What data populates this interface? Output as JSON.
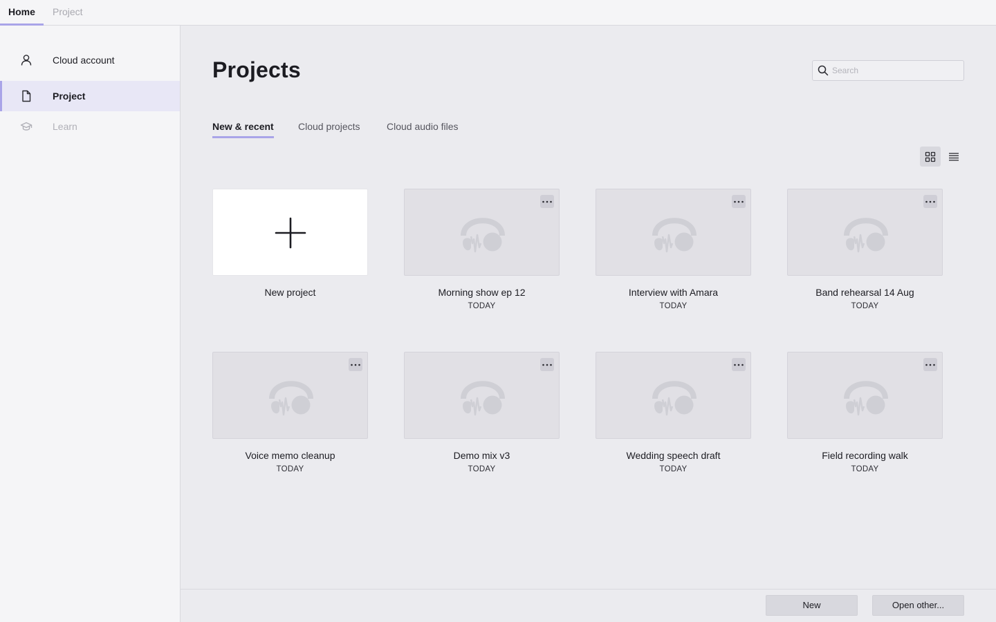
{
  "top_tabs": [
    {
      "label": "Home"
    },
    {
      "label": "Project"
    }
  ],
  "sidebar": {
    "items": [
      {
        "label": "Cloud account",
        "icon": "user-icon"
      },
      {
        "label": "Project",
        "icon": "document-icon"
      },
      {
        "label": "Learn",
        "icon": "graduation-cap-icon"
      }
    ]
  },
  "main": {
    "title": "Projects",
    "search": {
      "placeholder": "Search",
      "value": ""
    },
    "tabs": [
      {
        "label": "New & recent"
      },
      {
        "label": "Cloud projects"
      },
      {
        "label": "Cloud audio files"
      }
    ],
    "view_modes": [
      "grid-view-icon",
      "list-view-icon"
    ],
    "new_card": {
      "label": "New project",
      "icon": "plus-icon"
    },
    "projects": [
      {
        "title": "Morning show ep 12",
        "date": "TODAY"
      },
      {
        "title": "Interview with Amara",
        "date": "TODAY"
      },
      {
        "title": "Band rehearsal 14 Aug",
        "date": "TODAY"
      },
      {
        "title": "Voice memo cleanup",
        "date": "TODAY"
      },
      {
        "title": "Demo mix v3",
        "date": "TODAY"
      },
      {
        "title": "Wedding speech draft",
        "date": "TODAY"
      },
      {
        "title": "Field recording walk",
        "date": "TODAY"
      }
    ]
  },
  "footer": {
    "new_label": "New",
    "open_label": "Open other..."
  },
  "colors": {
    "accent": "#a9a4e8",
    "sidebar_selected": "#e8e7f6",
    "main_bg": "#ebebef",
    "thumb_bg": "#e1e0e5"
  }
}
